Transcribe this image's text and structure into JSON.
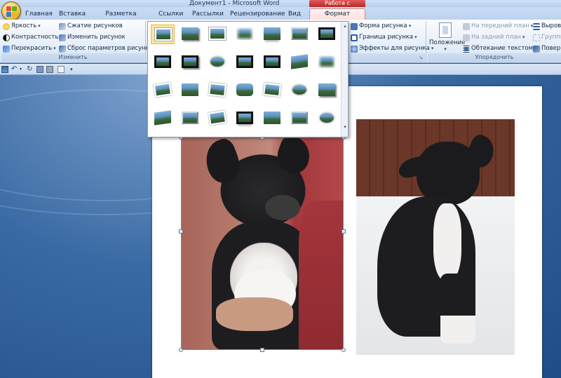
{
  "window": {
    "title": "Документ1 - Microsoft Word",
    "context_header": "Работа с рисунками"
  },
  "tabs": [
    {
      "label": "Главная"
    },
    {
      "label": "Вставка"
    },
    {
      "label": "Разметка страницы"
    },
    {
      "label": "Ссылки"
    },
    {
      "label": "Рассылки"
    },
    {
      "label": "Рецензирование"
    },
    {
      "label": "Вид"
    },
    {
      "label": "Формат"
    }
  ],
  "ribbon": {
    "adjust": {
      "brightness": "Яркость",
      "contrast": "Контрастность",
      "recolor": "Перекрасить",
      "compress": "Сжатие рисунков",
      "change_picture": "Изменить рисунок",
      "reset_picture": "Сброс параметров рисунка",
      "group_label": "Изменить"
    },
    "styles": {
      "shape": "Форма рисунка",
      "border": "Граница рисунка",
      "effects": "Эффекты для рисунка"
    },
    "arrange": {
      "position": "Положение",
      "bring_front": "На передний план",
      "send_back": "На задний план",
      "text_wrap": "Обтекание текстом",
      "align": "Выровн",
      "group": "Группи",
      "rotate": "Поверн",
      "group_label": "Упорядочить"
    }
  },
  "colors": {
    "ribbon_accent": "#d08a8a",
    "context_red": "#c53a3a",
    "selected_style": "#fde69a"
  }
}
